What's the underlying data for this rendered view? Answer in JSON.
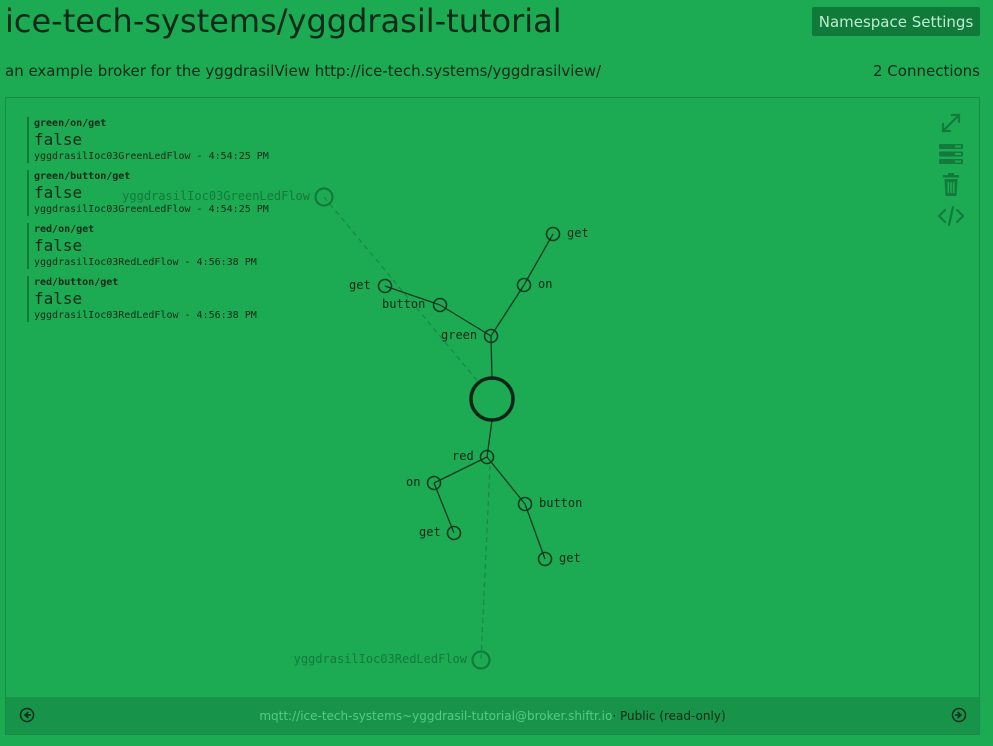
{
  "header": {
    "title": "ice-tech-systems/yggdrasil-tutorial",
    "namespace_settings_label": "Namespace Settings",
    "description": "an example broker for the yggdrasilView http://ice-tech.systems/yggdrasilview/",
    "connections": "2 Connections"
  },
  "messages": [
    {
      "topic": "green/on/get",
      "value": "false",
      "meta": "yggdrasilIoc03GreenLedFlow - 4:54:25 PM"
    },
    {
      "topic": "green/button/get",
      "value": "false",
      "meta": "yggdrasilIoc03GreenLedFlow - 4:54:25 PM"
    },
    {
      "topic": "red/on/get",
      "value": "false",
      "meta": "yggdrasilIoc03RedLedFlow - 4:56:38 PM"
    },
    {
      "topic": "red/button/get",
      "value": "false",
      "meta": "yggdrasilIoc03RedLedFlow - 4:56:38 PM"
    }
  ],
  "graph": {
    "nodes": {
      "green": "green",
      "green_on": "on",
      "green_on_get": "get",
      "green_button": "button",
      "green_button_get": "get",
      "red": "red",
      "red_on": "on",
      "red_on_get": "get",
      "red_button": "button",
      "red_button_get": "get"
    },
    "clients": {
      "green_client": "yggdrasilIoc03GreenLedFlow",
      "red_client": "yggdrasilIoc03RedLedFlow"
    }
  },
  "tools": [
    "expand-icon",
    "list-view-icon",
    "trash-icon",
    "code-icon"
  ],
  "footer": {
    "url": "mqtt://ice-tech-systems~yggdrasil-tutorial@broker.shiftr.io",
    "access": " · Public (read-only)"
  },
  "colors": {
    "background": "#1caa52",
    "button_bg": "#0f7a3a",
    "footer_bg": "#17934a",
    "dark": "#0f2a1a"
  }
}
